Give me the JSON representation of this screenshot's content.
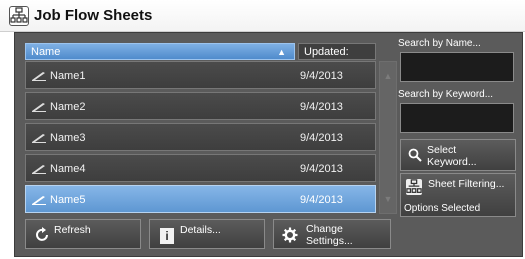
{
  "window": {
    "title": "Job Flow Sheets"
  },
  "list": {
    "columns": {
      "name": "Name",
      "updated": "Updated:"
    },
    "rows": [
      {
        "name": "Name1",
        "updated": "9/4/2013",
        "selected": false
      },
      {
        "name": "Name2",
        "updated": "9/4/2013",
        "selected": false
      },
      {
        "name": "Name3",
        "updated": "9/4/2013",
        "selected": false
      },
      {
        "name": "Name4",
        "updated": "9/4/2013",
        "selected": false
      },
      {
        "name": "Name5",
        "updated": "9/4/2013",
        "selected": true
      }
    ]
  },
  "search": {
    "by_name_label": "Search by Name...",
    "by_keyword_label": "Search by Keyword...",
    "select_keyword_line1": "Select",
    "select_keyword_line2": "Keyword...",
    "sheet_filtering_label": "Sheet Filtering...",
    "options_selected": "Options Selected"
  },
  "actions": {
    "refresh": "Refresh",
    "details": "Details...",
    "change_line1": "Change",
    "change_line2": "Settings..."
  },
  "icons": {
    "app": "sheet-hierarchy-icon",
    "row": "edit-pen-icon",
    "select_keyword": "search-icon",
    "filter": "sheet-hierarchy-icon",
    "refresh": "refresh-icon",
    "details": "info-icon",
    "change": "gear-icon"
  },
  "colors": {
    "panel": "#5b5b5b",
    "selected_row": "#6aa2dc",
    "row": "#444444"
  }
}
